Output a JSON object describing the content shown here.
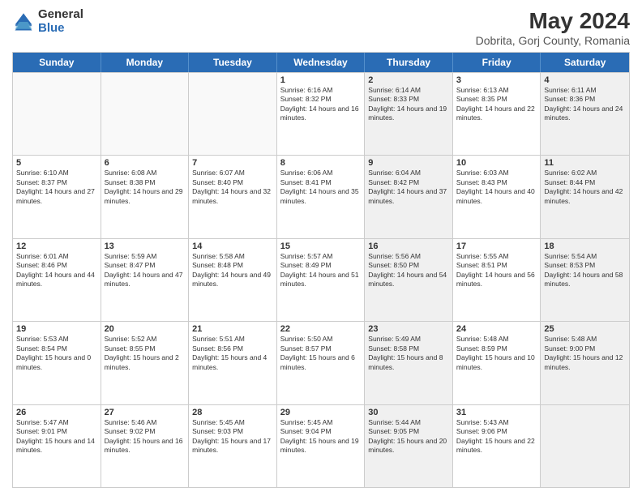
{
  "header": {
    "logo_general": "General",
    "logo_blue": "Blue",
    "main_title": "May 2024",
    "subtitle": "Dobrita, Gorj County, Romania"
  },
  "days": [
    "Sunday",
    "Monday",
    "Tuesday",
    "Wednesday",
    "Thursday",
    "Friday",
    "Saturday"
  ],
  "weeks": [
    [
      {
        "day": "",
        "empty": true,
        "shaded": false
      },
      {
        "day": "",
        "empty": true,
        "shaded": false
      },
      {
        "day": "",
        "empty": true,
        "shaded": false
      },
      {
        "day": "1",
        "empty": false,
        "shaded": false,
        "sunrise": "6:16 AM",
        "sunset": "8:32 PM",
        "daylight": "14 hours and 16 minutes."
      },
      {
        "day": "2",
        "empty": false,
        "shaded": true,
        "sunrise": "6:14 AM",
        "sunset": "8:33 PM",
        "daylight": "14 hours and 19 minutes."
      },
      {
        "day": "3",
        "empty": false,
        "shaded": false,
        "sunrise": "6:13 AM",
        "sunset": "8:35 PM",
        "daylight": "14 hours and 22 minutes."
      },
      {
        "day": "4",
        "empty": false,
        "shaded": true,
        "sunrise": "6:11 AM",
        "sunset": "8:36 PM",
        "daylight": "14 hours and 24 minutes."
      }
    ],
    [
      {
        "day": "5",
        "empty": false,
        "shaded": false,
        "sunrise": "6:10 AM",
        "sunset": "8:37 PM",
        "daylight": "14 hours and 27 minutes."
      },
      {
        "day": "6",
        "empty": false,
        "shaded": false,
        "sunrise": "6:08 AM",
        "sunset": "8:38 PM",
        "daylight": "14 hours and 29 minutes."
      },
      {
        "day": "7",
        "empty": false,
        "shaded": false,
        "sunrise": "6:07 AM",
        "sunset": "8:40 PM",
        "daylight": "14 hours and 32 minutes."
      },
      {
        "day": "8",
        "empty": false,
        "shaded": false,
        "sunrise": "6:06 AM",
        "sunset": "8:41 PM",
        "daylight": "14 hours and 35 minutes."
      },
      {
        "day": "9",
        "empty": false,
        "shaded": true,
        "sunrise": "6:04 AM",
        "sunset": "8:42 PM",
        "daylight": "14 hours and 37 minutes."
      },
      {
        "day": "10",
        "empty": false,
        "shaded": false,
        "sunrise": "6:03 AM",
        "sunset": "8:43 PM",
        "daylight": "14 hours and 40 minutes."
      },
      {
        "day": "11",
        "empty": false,
        "shaded": true,
        "sunrise": "6:02 AM",
        "sunset": "8:44 PM",
        "daylight": "14 hours and 42 minutes."
      }
    ],
    [
      {
        "day": "12",
        "empty": false,
        "shaded": false,
        "sunrise": "6:01 AM",
        "sunset": "8:46 PM",
        "daylight": "14 hours and 44 minutes."
      },
      {
        "day": "13",
        "empty": false,
        "shaded": false,
        "sunrise": "5:59 AM",
        "sunset": "8:47 PM",
        "daylight": "14 hours and 47 minutes."
      },
      {
        "day": "14",
        "empty": false,
        "shaded": false,
        "sunrise": "5:58 AM",
        "sunset": "8:48 PM",
        "daylight": "14 hours and 49 minutes."
      },
      {
        "day": "15",
        "empty": false,
        "shaded": false,
        "sunrise": "5:57 AM",
        "sunset": "8:49 PM",
        "daylight": "14 hours and 51 minutes."
      },
      {
        "day": "16",
        "empty": false,
        "shaded": true,
        "sunrise": "5:56 AM",
        "sunset": "8:50 PM",
        "daylight": "14 hours and 54 minutes."
      },
      {
        "day": "17",
        "empty": false,
        "shaded": false,
        "sunrise": "5:55 AM",
        "sunset": "8:51 PM",
        "daylight": "14 hours and 56 minutes."
      },
      {
        "day": "18",
        "empty": false,
        "shaded": true,
        "sunrise": "5:54 AM",
        "sunset": "8:53 PM",
        "daylight": "14 hours and 58 minutes."
      }
    ],
    [
      {
        "day": "19",
        "empty": false,
        "shaded": false,
        "sunrise": "5:53 AM",
        "sunset": "8:54 PM",
        "daylight": "15 hours and 0 minutes."
      },
      {
        "day": "20",
        "empty": false,
        "shaded": false,
        "sunrise": "5:52 AM",
        "sunset": "8:55 PM",
        "daylight": "15 hours and 2 minutes."
      },
      {
        "day": "21",
        "empty": false,
        "shaded": false,
        "sunrise": "5:51 AM",
        "sunset": "8:56 PM",
        "daylight": "15 hours and 4 minutes."
      },
      {
        "day": "22",
        "empty": false,
        "shaded": false,
        "sunrise": "5:50 AM",
        "sunset": "8:57 PM",
        "daylight": "15 hours and 6 minutes."
      },
      {
        "day": "23",
        "empty": false,
        "shaded": true,
        "sunrise": "5:49 AM",
        "sunset": "8:58 PM",
        "daylight": "15 hours and 8 minutes."
      },
      {
        "day": "24",
        "empty": false,
        "shaded": false,
        "sunrise": "5:48 AM",
        "sunset": "8:59 PM",
        "daylight": "15 hours and 10 minutes."
      },
      {
        "day": "25",
        "empty": false,
        "shaded": true,
        "sunrise": "5:48 AM",
        "sunset": "9:00 PM",
        "daylight": "15 hours and 12 minutes."
      }
    ],
    [
      {
        "day": "26",
        "empty": false,
        "shaded": false,
        "sunrise": "5:47 AM",
        "sunset": "9:01 PM",
        "daylight": "15 hours and 14 minutes."
      },
      {
        "day": "27",
        "empty": false,
        "shaded": false,
        "sunrise": "5:46 AM",
        "sunset": "9:02 PM",
        "daylight": "15 hours and 16 minutes."
      },
      {
        "day": "28",
        "empty": false,
        "shaded": false,
        "sunrise": "5:45 AM",
        "sunset": "9:03 PM",
        "daylight": "15 hours and 17 minutes."
      },
      {
        "day": "29",
        "empty": false,
        "shaded": false,
        "sunrise": "5:45 AM",
        "sunset": "9:04 PM",
        "daylight": "15 hours and 19 minutes."
      },
      {
        "day": "30",
        "empty": false,
        "shaded": true,
        "sunrise": "5:44 AM",
        "sunset": "9:05 PM",
        "daylight": "15 hours and 20 minutes."
      },
      {
        "day": "31",
        "empty": false,
        "shaded": false,
        "sunrise": "5:43 AM",
        "sunset": "9:06 PM",
        "daylight": "15 hours and 22 minutes."
      },
      {
        "day": "",
        "empty": true,
        "shaded": true
      }
    ]
  ],
  "labels": {
    "sunrise": "Sunrise:",
    "sunset": "Sunset:",
    "daylight": "Daylight:"
  }
}
